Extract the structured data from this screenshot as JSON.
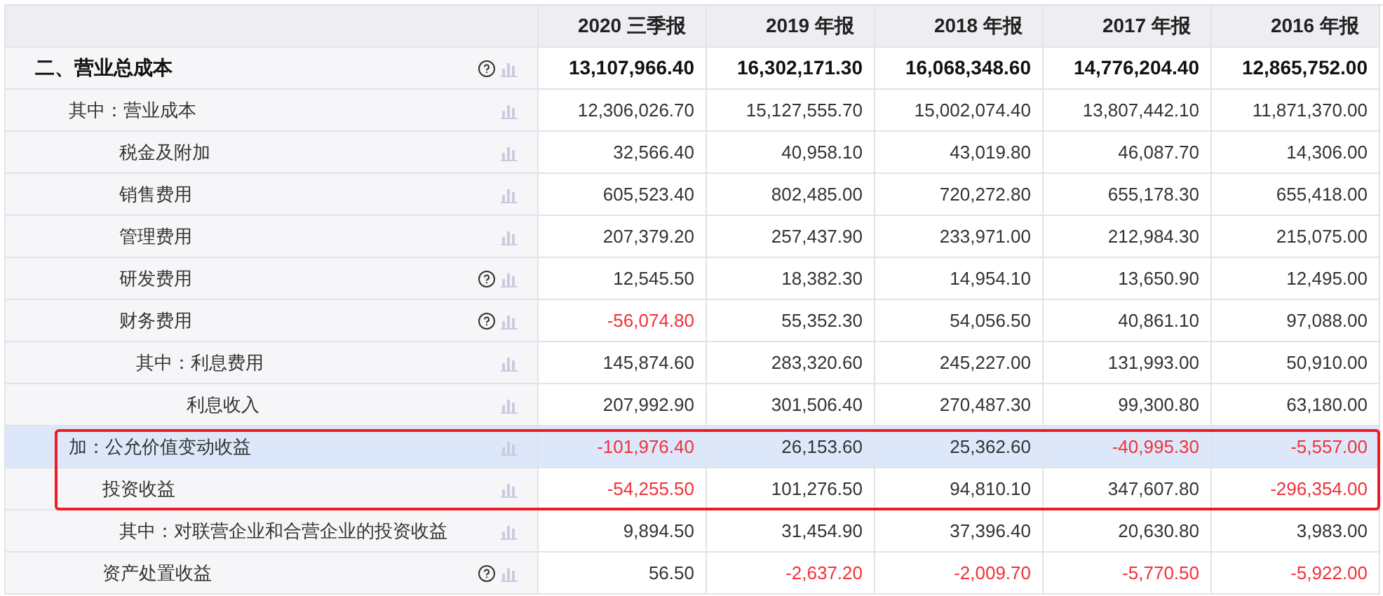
{
  "columns": [
    "2020 三季报",
    "2019 年报",
    "2018 年报",
    "2017 年报",
    "2016 年报"
  ],
  "rows": [
    {
      "label": "二、营业总成本",
      "kind": "total",
      "help": true,
      "selected": false,
      "boxed": false,
      "values": [
        "13,107,966.40",
        "16,302,171.30",
        "16,068,348.60",
        "14,776,204.40",
        "12,865,752.00"
      ],
      "negative": [
        false,
        false,
        false,
        false,
        false
      ]
    },
    {
      "label": "其中：营业成本",
      "kind": "of-which",
      "help": false,
      "selected": false,
      "boxed": false,
      "values": [
        "12,306,026.70",
        "15,127,555.70",
        "15,002,074.40",
        "13,807,442.10",
        "11,871,370.00"
      ],
      "negative": [
        false,
        false,
        false,
        false,
        false
      ]
    },
    {
      "label": "税金及附加",
      "kind": "detail",
      "help": false,
      "selected": false,
      "boxed": false,
      "values": [
        "32,566.40",
        "40,958.10",
        "43,019.80",
        "46,087.70",
        "14,306.00"
      ],
      "negative": [
        false,
        false,
        false,
        false,
        false
      ]
    },
    {
      "label": "销售费用",
      "kind": "detail",
      "help": false,
      "selected": false,
      "boxed": false,
      "values": [
        "605,523.40",
        "802,485.00",
        "720,272.80",
        "655,178.30",
        "655,418.00"
      ],
      "negative": [
        false,
        false,
        false,
        false,
        false
      ]
    },
    {
      "label": "管理费用",
      "kind": "detail",
      "help": false,
      "selected": false,
      "boxed": false,
      "values": [
        "207,379.20",
        "257,437.90",
        "233,971.00",
        "212,984.30",
        "215,075.00"
      ],
      "negative": [
        false,
        false,
        false,
        false,
        false
      ]
    },
    {
      "label": "研发费用",
      "kind": "detail",
      "help": true,
      "selected": false,
      "boxed": false,
      "values": [
        "12,545.50",
        "18,382.30",
        "14,954.10",
        "13,650.90",
        "12,495.00"
      ],
      "negative": [
        false,
        false,
        false,
        false,
        false
      ]
    },
    {
      "label": "财务费用",
      "kind": "detail",
      "help": true,
      "selected": false,
      "boxed": false,
      "values": [
        "-56,074.80",
        "55,352.30",
        "54,056.50",
        "40,861.10",
        "97,088.00"
      ],
      "negative": [
        true,
        false,
        false,
        false,
        false
      ]
    },
    {
      "label": "其中：利息费用",
      "kind": "sub-of-which",
      "help": false,
      "selected": false,
      "boxed": false,
      "values": [
        "145,874.60",
        "283,320.60",
        "245,227.00",
        "131,993.00",
        "50,910.00"
      ],
      "negative": [
        false,
        false,
        false,
        false,
        false
      ]
    },
    {
      "label": "利息收入",
      "kind": "sub-detail",
      "help": false,
      "selected": false,
      "boxed": false,
      "values": [
        "207,992.90",
        "301,506.40",
        "270,487.30",
        "99,300.80",
        "63,180.00"
      ],
      "negative": [
        false,
        false,
        false,
        false,
        false
      ]
    },
    {
      "label": "加：公允价值变动收益",
      "kind": "of-which",
      "help": false,
      "selected": true,
      "boxed": true,
      "values": [
        "-101,976.40",
        "26,153.60",
        "25,362.60",
        "-40,995.30",
        "-5,557.00"
      ],
      "negative": [
        true,
        false,
        false,
        true,
        true
      ]
    },
    {
      "label": "投资收益",
      "kind": "item",
      "help": false,
      "selected": false,
      "boxed": true,
      "values": [
        "-54,255.50",
        "101,276.50",
        "94,810.10",
        "347,607.80",
        "-296,354.00"
      ],
      "negative": [
        true,
        false,
        false,
        false,
        true
      ]
    },
    {
      "label": "其中：对联营企业和合营企业的投资收益",
      "kind": "detail",
      "help": false,
      "selected": false,
      "boxed": false,
      "values": [
        "9,894.50",
        "31,454.90",
        "37,396.40",
        "20,630.80",
        "3,983.00"
      ],
      "negative": [
        false,
        false,
        false,
        false,
        false
      ]
    },
    {
      "label": "资产处置收益",
      "kind": "item",
      "help": true,
      "selected": false,
      "boxed": false,
      "values": [
        "56.50",
        "-2,637.20",
        "-2,009.70",
        "-5,770.50",
        "-5,922.00"
      ],
      "negative": [
        false,
        true,
        true,
        true,
        true
      ]
    }
  ]
}
